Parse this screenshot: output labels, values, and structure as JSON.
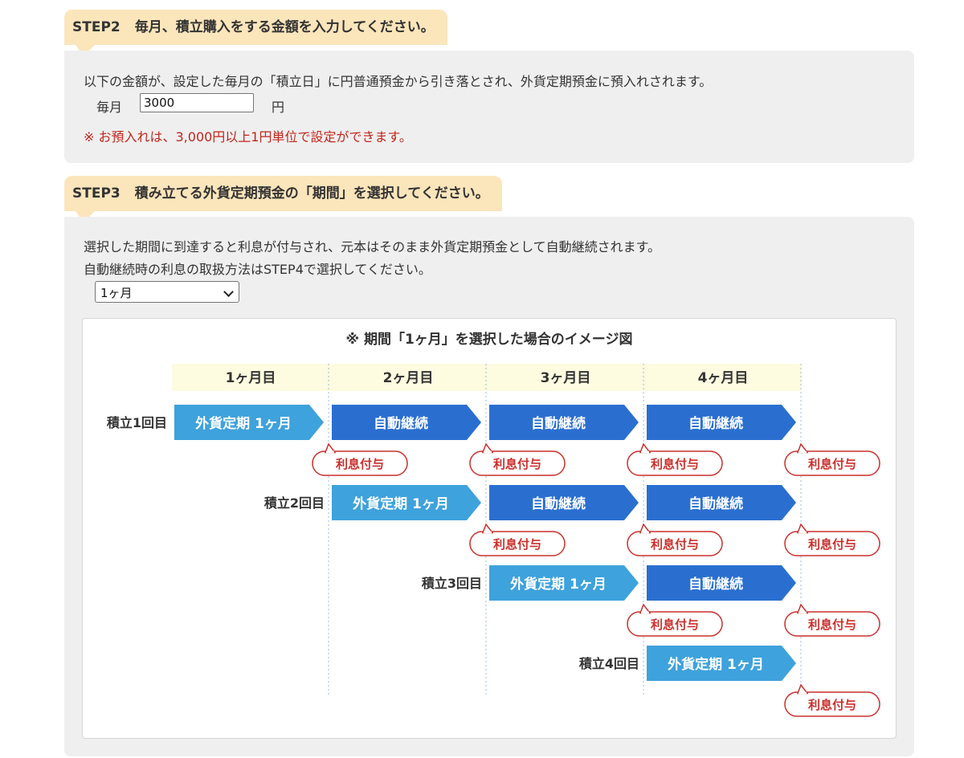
{
  "step2": {
    "step_label": "STEP2",
    "title": "毎月、積立購入をする金額を入力してください。",
    "description": "以下の金額が、設定した毎月の「積立日」に円普通預金から引き落とされ、外貨定期預金に預入れされます。",
    "monthly_label": "毎月",
    "amount_value": "3000",
    "unit_label": "円",
    "note": "※ お預入れは、3,000円以上1円単位で設定ができます。"
  },
  "step3": {
    "step_label": "STEP3",
    "title": "積み立てる外貨定期預金の「期間」を選択してください。",
    "description_line1": "選択した期間に到達すると利息が付与され、元本はそのまま外貨定期預金として自動継続されます。",
    "description_line2": "自動継続時の利息の取扱方法はSTEP4で選択してください。",
    "period_selected": "1ヶ月"
  },
  "diagram": {
    "caption": "※ 期間「1ヶ月」を選択した場合のイメージ図",
    "months": [
      "1ヶ月目",
      "2ヶ月目",
      "3ヶ月目",
      "4ヶ月目"
    ],
    "rows": [
      {
        "label": "積立1回目",
        "start": 0
      },
      {
        "label": "積立2回目",
        "start": 1
      },
      {
        "label": "積立3回目",
        "start": 2
      },
      {
        "label": "積立4回目",
        "start": 3
      }
    ],
    "first_block_label": "外貨定期  1ヶ月",
    "renew_block_label": "自動継続",
    "interest_label": "利息付与",
    "colors": {
      "first_block": "#3ea2dc",
      "renew_block": "#2a6fd0",
      "month_header": "#fdfbe0",
      "interest_border": "#c9302c"
    }
  }
}
